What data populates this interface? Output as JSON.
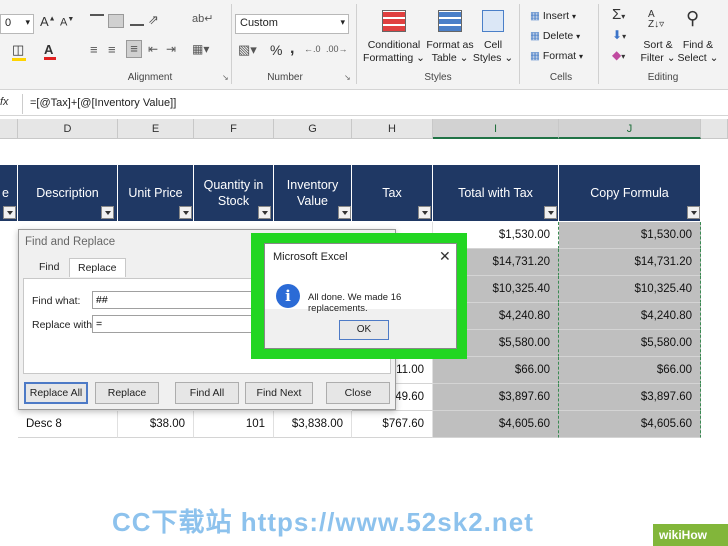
{
  "ribbon": {
    "font_size_value": "0",
    "number_format": "Custom",
    "groups": {
      "alignment": "Alignment",
      "number": "Number",
      "styles": "Styles",
      "cells": "Cells",
      "editing": "Editing"
    },
    "styles_buttons": {
      "conditional": [
        "Conditional",
        "Formatting ⌄"
      ],
      "format_table": [
        "Format as",
        "Table ⌄"
      ],
      "cell_styles": [
        "Cell",
        "Styles ⌄"
      ]
    },
    "cells_buttons": {
      "insert": "Insert",
      "delete": "Delete",
      "format": "Format"
    },
    "editing_buttons": {
      "sort_filter": [
        "Sort &",
        "Filter ⌄"
      ],
      "find_select": [
        "Find &",
        "Select ⌄"
      ]
    },
    "percent": "%",
    "comma": ","
  },
  "formula_bar": {
    "fx": "fx",
    "formula": "=[@Tax]+[@[Inventory Value]]"
  },
  "columns": [
    "D",
    "E",
    "F",
    "G",
    "H",
    "I",
    "J"
  ],
  "table_headers": {
    "e": "e",
    "description": "Description",
    "unit_price": "Unit Price",
    "quantity": [
      "Quantity in",
      "Stock"
    ],
    "inventory": [
      "Inventory",
      "Value"
    ],
    "tax": "Tax",
    "total_tax": "Total with Tax",
    "copy_formula": "Copy Formula"
  },
  "rows": [
    {
      "h": "",
      "i": "$1,530.00",
      "j": "$1,530.00"
    },
    {
      "h": "",
      "i": "$14,731.20",
      "j": "$14,731.20"
    },
    {
      "h": "",
      "i": "$10,325.40",
      "j": "$10,325.40"
    },
    {
      "h": "",
      "i": "$4,240.80",
      "j": "$4,240.80"
    },
    {
      "h": "",
      "i": "$5,580.00",
      "j": "$5,580.00"
    },
    {
      "h": "11.00",
      "i": "$66.00",
      "j": "$66.00"
    },
    {
      "h": "49.60",
      "i": "$3,897.60",
      "j": "$3,897.60"
    }
  ],
  "last_row": {
    "description": "Desc 8",
    "unit_price": "$38.00",
    "quantity": "101",
    "inventory": "$3,838.00",
    "tax": "$767.60",
    "total": "$4,605.60",
    "copy": "$4,605.60"
  },
  "find_replace": {
    "title": "Find and Replace",
    "tab_find": "Find",
    "tab_replace": "Replace",
    "find_what_label": "Find what:",
    "find_what_value": "##",
    "replace_with_label": "Replace with:",
    "replace_with_value": "=",
    "buttons": {
      "replace_all": "Replace All",
      "replace": "Replace",
      "find_all": "Find All",
      "find_next": "Find Next",
      "close": "Close"
    }
  },
  "message_box": {
    "title": "Microsoft Excel",
    "close": "✕",
    "icon": "i",
    "text": "All done. We made 16 replacements.",
    "ok": "OK"
  },
  "watermark": "CC下载站  https://www.52sk2.net",
  "badge": "wikiHow",
  "colors": {
    "table_header": "#1f3864",
    "highlight": "#22d622",
    "excel_green": "#217346"
  }
}
